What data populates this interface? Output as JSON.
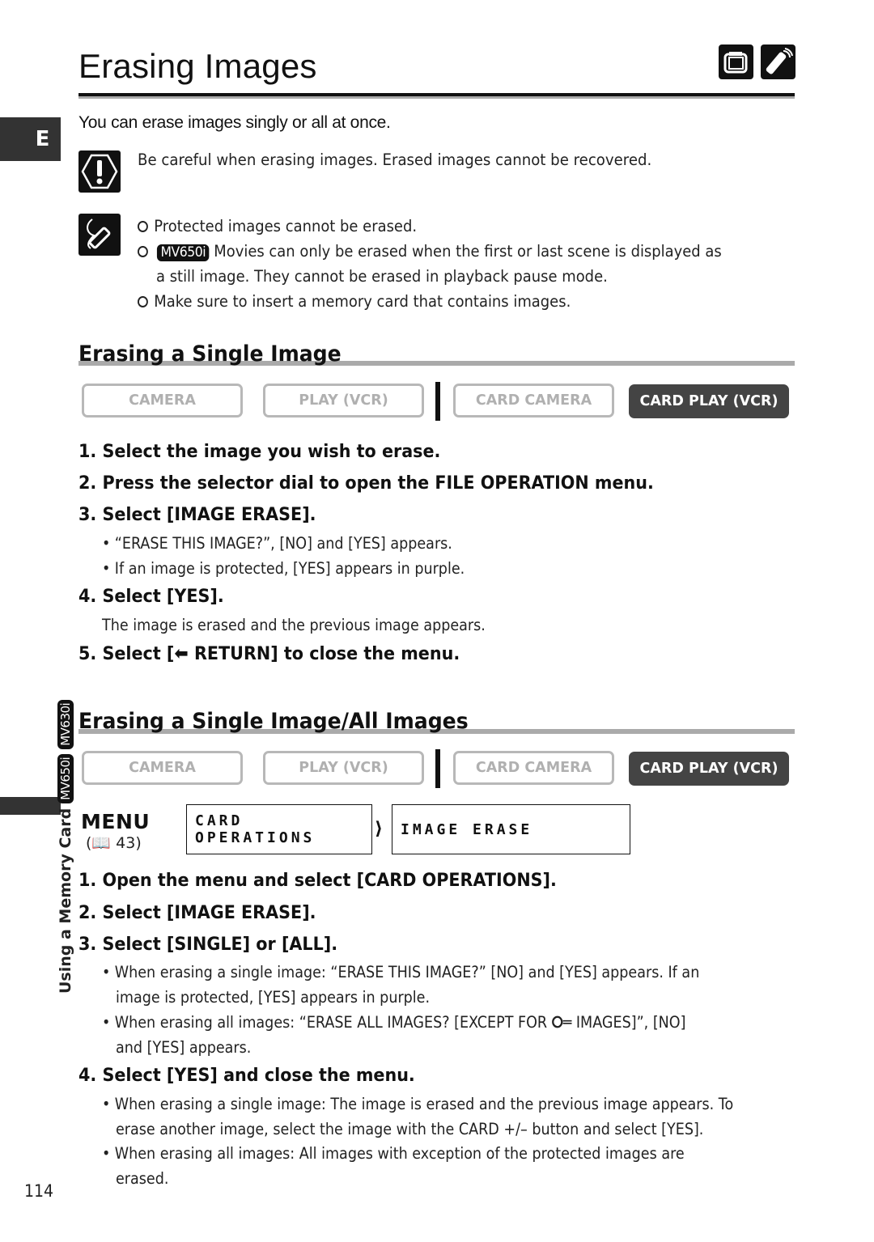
{
  "header": {
    "title": "Erasing Images",
    "icons": [
      "camcorder-icon",
      "remote-control-icon"
    ]
  },
  "language_tab": "E",
  "intro": "You can erase images singly or all at once.",
  "caution": {
    "icon": "caution-icon",
    "text": "Be careful when erasing images. Erased images cannot be recovered."
  },
  "notes": {
    "icon": "note-pencil-icon",
    "items": [
      {
        "text": "Protected images cannot be erased."
      },
      {
        "badge": "MV650i",
        "text": "Movies can only be erased when the first or last scene is displayed as",
        "continuation": "a still image. They cannot be erased in playback pause mode."
      },
      {
        "text": "Make sure to insert a memory card that contains images."
      }
    ]
  },
  "sections": [
    {
      "title": "Erasing a Single Image",
      "modes": [
        {
          "label": "CAMERA",
          "active": false
        },
        {
          "label": "PLAY (VCR)",
          "active": false
        },
        {
          "label": "CARD CAMERA",
          "active": false
        },
        {
          "label": "CARD PLAY (VCR)",
          "active": true
        }
      ],
      "steps": [
        {
          "label": "1. Select the image you wish to erase."
        },
        {
          "label": "2. Press the selector dial to open the FILE OPERATION menu."
        },
        {
          "label": "3. Select [IMAGE ERASE].",
          "bullets": [
            "“ERASE THIS IMAGE?”, [NO] and [YES] appears.",
            "If an image is protected, [YES] appears in purple."
          ]
        },
        {
          "label": "4. Select [YES].",
          "note": "The image is erased and the previous image appears."
        },
        {
          "label_before": "5. Select [",
          "icon": "return-arrow-icon",
          "label_after": " RETURN] to close the menu."
        }
      ]
    },
    {
      "title": "Erasing a Single Image/All Images",
      "modes": [
        {
          "label": "CAMERA",
          "active": false
        },
        {
          "label": "PLAY (VCR)",
          "active": false
        },
        {
          "label": "CARD CAMERA",
          "active": false
        },
        {
          "label": "CARD PLAY (VCR)",
          "active": true
        }
      ],
      "menu": {
        "word": "MENU",
        "ref_page": "43",
        "path": [
          "CARD OPERATIONS",
          "IMAGE ERASE"
        ]
      },
      "steps": [
        {
          "label": "1. Open the menu and select [CARD OPERATIONS]."
        },
        {
          "label": "2. Select [IMAGE ERASE]."
        },
        {
          "label": "3. Select [SINGLE] or [ALL].",
          "bullets": [
            {
              "line1": "When erasing a single image: “ERASE THIS IMAGE?” [NO] and [YES] appears. If an",
              "line2": "image is protected, [YES] appears in purple."
            },
            {
              "line1_before": "When erasing all images: “ERASE ALL IMAGES? [EXCEPT FOR ",
              "icon": "key-icon",
              "line1_after": " IMAGES]”, [NO]",
              "line2": "and [YES] appears."
            }
          ]
        },
        {
          "label": "4. Select [YES] and close the menu.",
          "bullets": [
            {
              "line1": "When erasing a single image: The image is erased and the previous image appears. To",
              "line2": "erase another image, select the image with the CARD +/– button and select [YES]."
            },
            {
              "line1": "When erasing all images: All images with exception of the protected images are",
              "line2": "erased."
            }
          ]
        }
      ]
    }
  ],
  "side_label": {
    "text": "Using a Memory Card",
    "badges": [
      "MV650i",
      "MV630i"
    ]
  },
  "page_number": "114"
}
